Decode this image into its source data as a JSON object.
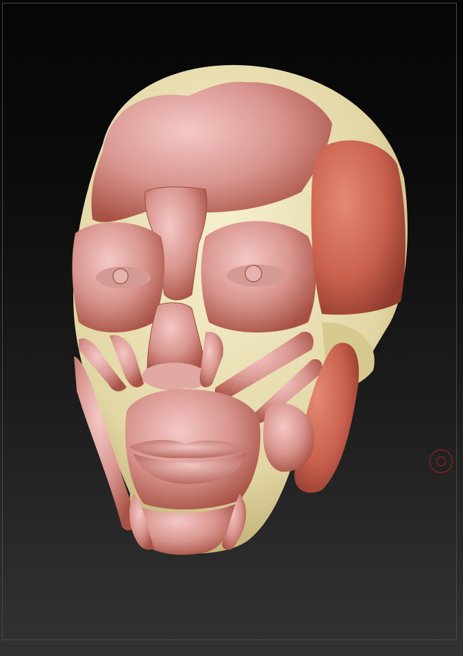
{
  "viewport": {
    "background_top": "#050505",
    "background_bottom": "#333333",
    "frame_color": "#4a4a4a"
  },
  "model": {
    "skull_color": "#e8dfb4",
    "muscle_color": "#d9958f",
    "muscle_dark": "#b25a4a",
    "temporalis_color": "#c9604d"
  },
  "gizmo": {
    "icon": "rotation-pivot-icon",
    "color": "#b02020"
  }
}
